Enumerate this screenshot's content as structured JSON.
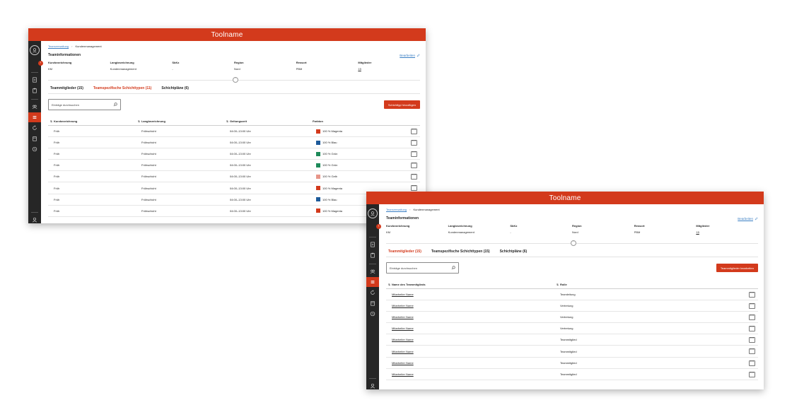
{
  "colors": {
    "brand": "#d33a1c",
    "rail": "#262626",
    "link": "#3b7fc4"
  },
  "windows": [
    {
      "title": "Toolname",
      "breadcrumb": {
        "link": "Teamverwaltung",
        "current": "Kundenmanagement"
      },
      "section_title": "Teaminformationen",
      "edit_label": "Bearbeiten",
      "info": [
        {
          "label": "Kurzbezeichnung",
          "value": "KM"
        },
        {
          "label": "Langbezeichnung",
          "value": "Kundenmanagement"
        },
        {
          "label": "SbKz",
          "value": "-"
        },
        {
          "label": "Region",
          "value": "Nord"
        },
        {
          "label": "Ressort",
          "value": "PBM"
        },
        {
          "label": "Mitglieder",
          "value": "15"
        }
      ],
      "tabs": [
        {
          "label": "Teammitglieder (15)",
          "active": false
        },
        {
          "label": "Teamspezifische Schichttypen (11)",
          "active": true
        },
        {
          "label": "Schichtpläne (6)",
          "active": false
        }
      ],
      "search_placeholder": "Einträge durchsuchen",
      "action_button": "Schichttyp hinzufügen",
      "columns": [
        "Kurzbezeichnung",
        "Langbezeichnung",
        "Geltungszeit",
        "Farbton"
      ],
      "rows": [
        {
          "kurz": "Früh",
          "lang": "Frühschicht",
          "zeit": "04:00–13:00 Uhr",
          "farbe": "100 % Magenta",
          "color": "#d33a1c"
        },
        {
          "kurz": "Früh",
          "lang": "Frühschicht",
          "zeit": "04:00–13:00 Uhr",
          "farbe": "100 % Blau",
          "color": "#1d5a9a"
        },
        {
          "kurz": "Früh",
          "lang": "Frühschicht",
          "zeit": "04:00–13:00 Uhr",
          "farbe": "100 % Grün",
          "color": "#1e8a5a"
        },
        {
          "kurz": "Früh",
          "lang": "Frühschicht",
          "zeit": "04:00–13:00 Uhr",
          "farbe": "100 % Grün",
          "color": "#1e8a5a"
        },
        {
          "kurz": "Früh",
          "lang": "Frühschicht",
          "zeit": "04:00–13:00 Uhr",
          "farbe": "100 % Gelb",
          "color": "#e7968a"
        },
        {
          "kurz": "Früh",
          "lang": "Frühschicht",
          "zeit": "04:00–13:00 Uhr",
          "farbe": "100 % Magenta",
          "color": "#d33a1c"
        },
        {
          "kurz": "Früh",
          "lang": "Frühschicht",
          "zeit": "04:00–13:00 Uhr",
          "farbe": "100 % Blau",
          "color": "#1d5a9a"
        },
        {
          "kurz": "Früh",
          "lang": "Frühschicht",
          "zeit": "04:00–13:00 Uhr",
          "farbe": "100 % Magenta",
          "color": "#d33a1c"
        }
      ]
    },
    {
      "title": "Toolname",
      "breadcrumb": {
        "link": "Teamverwaltung",
        "current": "Kundenmanagement"
      },
      "section_title": "Teaminformationen",
      "edit_label": "Bearbeiten",
      "info": [
        {
          "label": "Kurzbezeichnung",
          "value": "KM"
        },
        {
          "label": "Langbezeichnung",
          "value": "Kundenmanagement"
        },
        {
          "label": "SbKz",
          "value": "-"
        },
        {
          "label": "Region",
          "value": "Nord"
        },
        {
          "label": "Ressort",
          "value": "PBM"
        },
        {
          "label": "Mitglieder",
          "value": "15"
        }
      ],
      "tabs": [
        {
          "label": "Teammitglieder (15)",
          "active": true
        },
        {
          "label": "Teamspezifische Schichttypen (15)",
          "active": false
        },
        {
          "label": "Schichtpläne (6)",
          "active": false
        }
      ],
      "search_placeholder": "Einträge durchsuchen",
      "action_button": "Teammitglieder bearbeiten",
      "columns": [
        "Name des Teammitglieds",
        "Rolle"
      ],
      "rows": [
        {
          "name": "Mitarbeiter Name",
          "rolle": "Teamleitung"
        },
        {
          "name": "Mitarbeiter Name",
          "rolle": "Vertretung"
        },
        {
          "name": "Mitarbeiter Name",
          "rolle": "Vertretung"
        },
        {
          "name": "Mitarbeiter Name",
          "rolle": "Vertretung"
        },
        {
          "name": "Mitarbeiter Name",
          "rolle": "Teammitglied"
        },
        {
          "name": "Mitarbeiter Name",
          "rolle": "Teammitglied"
        },
        {
          "name": "Mitarbeiter Name",
          "rolle": "Teammitglied"
        },
        {
          "name": "Mitarbeiter Name",
          "rolle": "Teammitglied"
        }
      ]
    }
  ]
}
